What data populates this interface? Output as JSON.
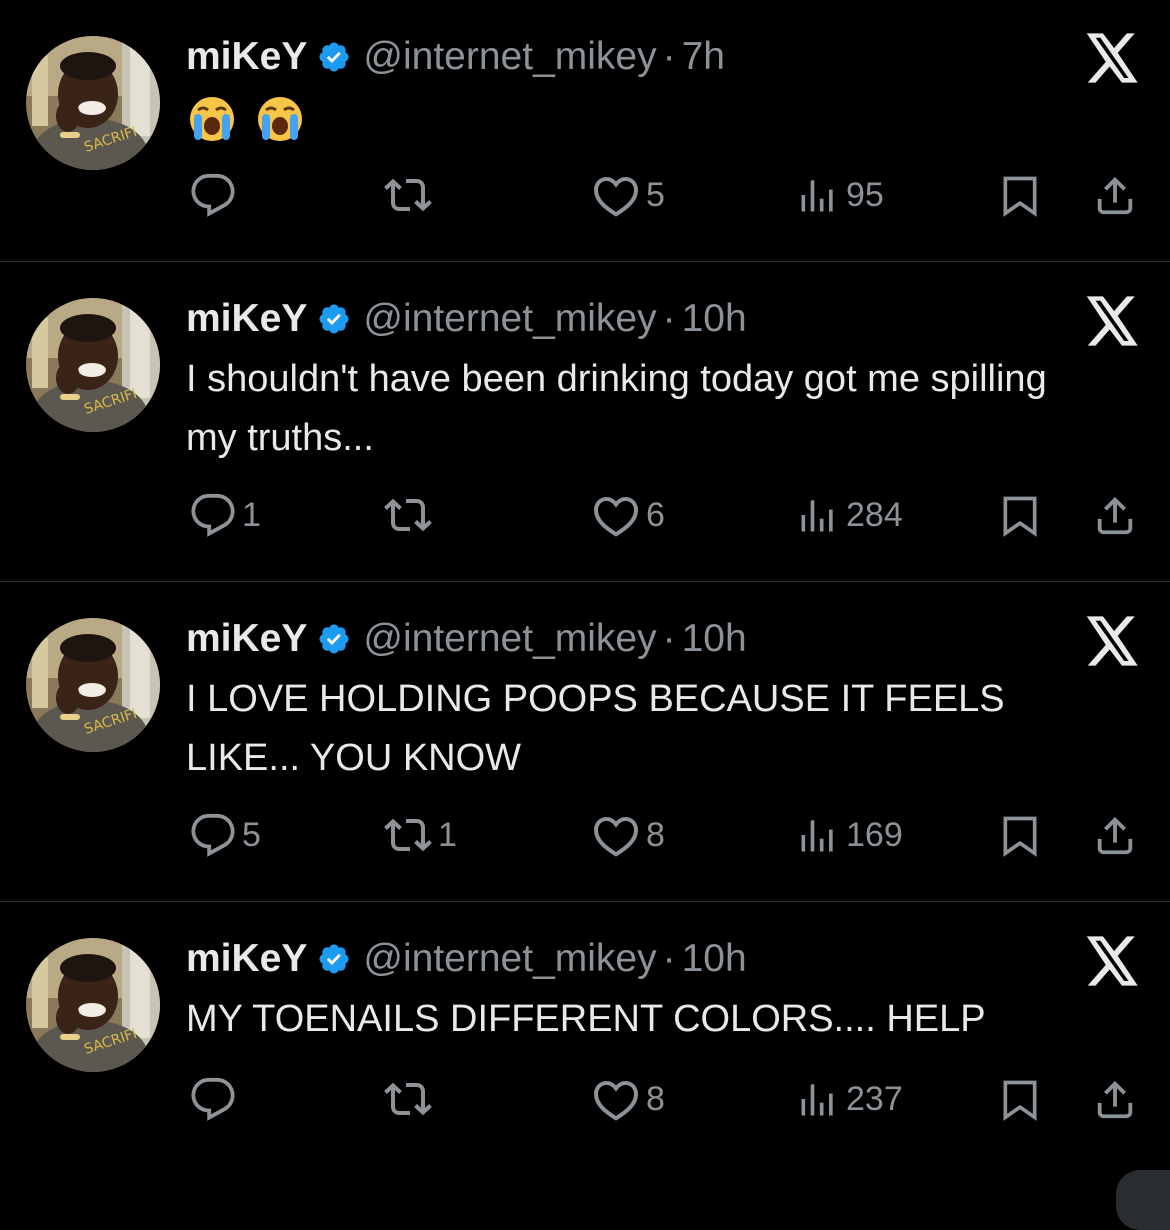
{
  "colors": {
    "background": "#000000",
    "text": "#e7e9ea",
    "muted": "#8b9298",
    "divider": "#2f3336",
    "verified_badge": "#1d9bf0"
  },
  "tweets": [
    {
      "name": "miKeY",
      "handle": "@internet_mikey",
      "separator": "·",
      "time": "7h",
      "text": "",
      "emoji": [
        "😭",
        "😭"
      ],
      "replies": "",
      "reposts": "",
      "likes": "5",
      "views": "95"
    },
    {
      "name": "miKeY",
      "handle": "@internet_mikey",
      "separator": "·",
      "time": "10h",
      "text": "I shouldn't have been drinking today got me spilling my truths...",
      "replies": "1",
      "reposts": "",
      "likes": "6",
      "views": "284"
    },
    {
      "name": "miKeY",
      "handle": "@internet_mikey",
      "separator": "·",
      "time": "10h",
      "text": "I LOVE HOLDING POOPS BECAUSE IT FEELS LIKE... YOU KNOW",
      "replies": "5",
      "reposts": "1",
      "likes": "8",
      "views": "169"
    },
    {
      "name": "miKeY",
      "handle": "@internet_mikey",
      "separator": "·",
      "time": "10h",
      "text": "MY TOENAILS DIFFERENT COLORS.... HELP",
      "replies": "",
      "reposts": "",
      "likes": "8",
      "views": "237"
    }
  ],
  "icons": {
    "reply": "reply-icon",
    "repost": "repost-icon",
    "like": "heart-icon",
    "views": "views-icon",
    "bookmark": "bookmark-icon",
    "share": "share-icon",
    "verified": "verified-badge-icon",
    "platform": "x-logo-icon"
  }
}
